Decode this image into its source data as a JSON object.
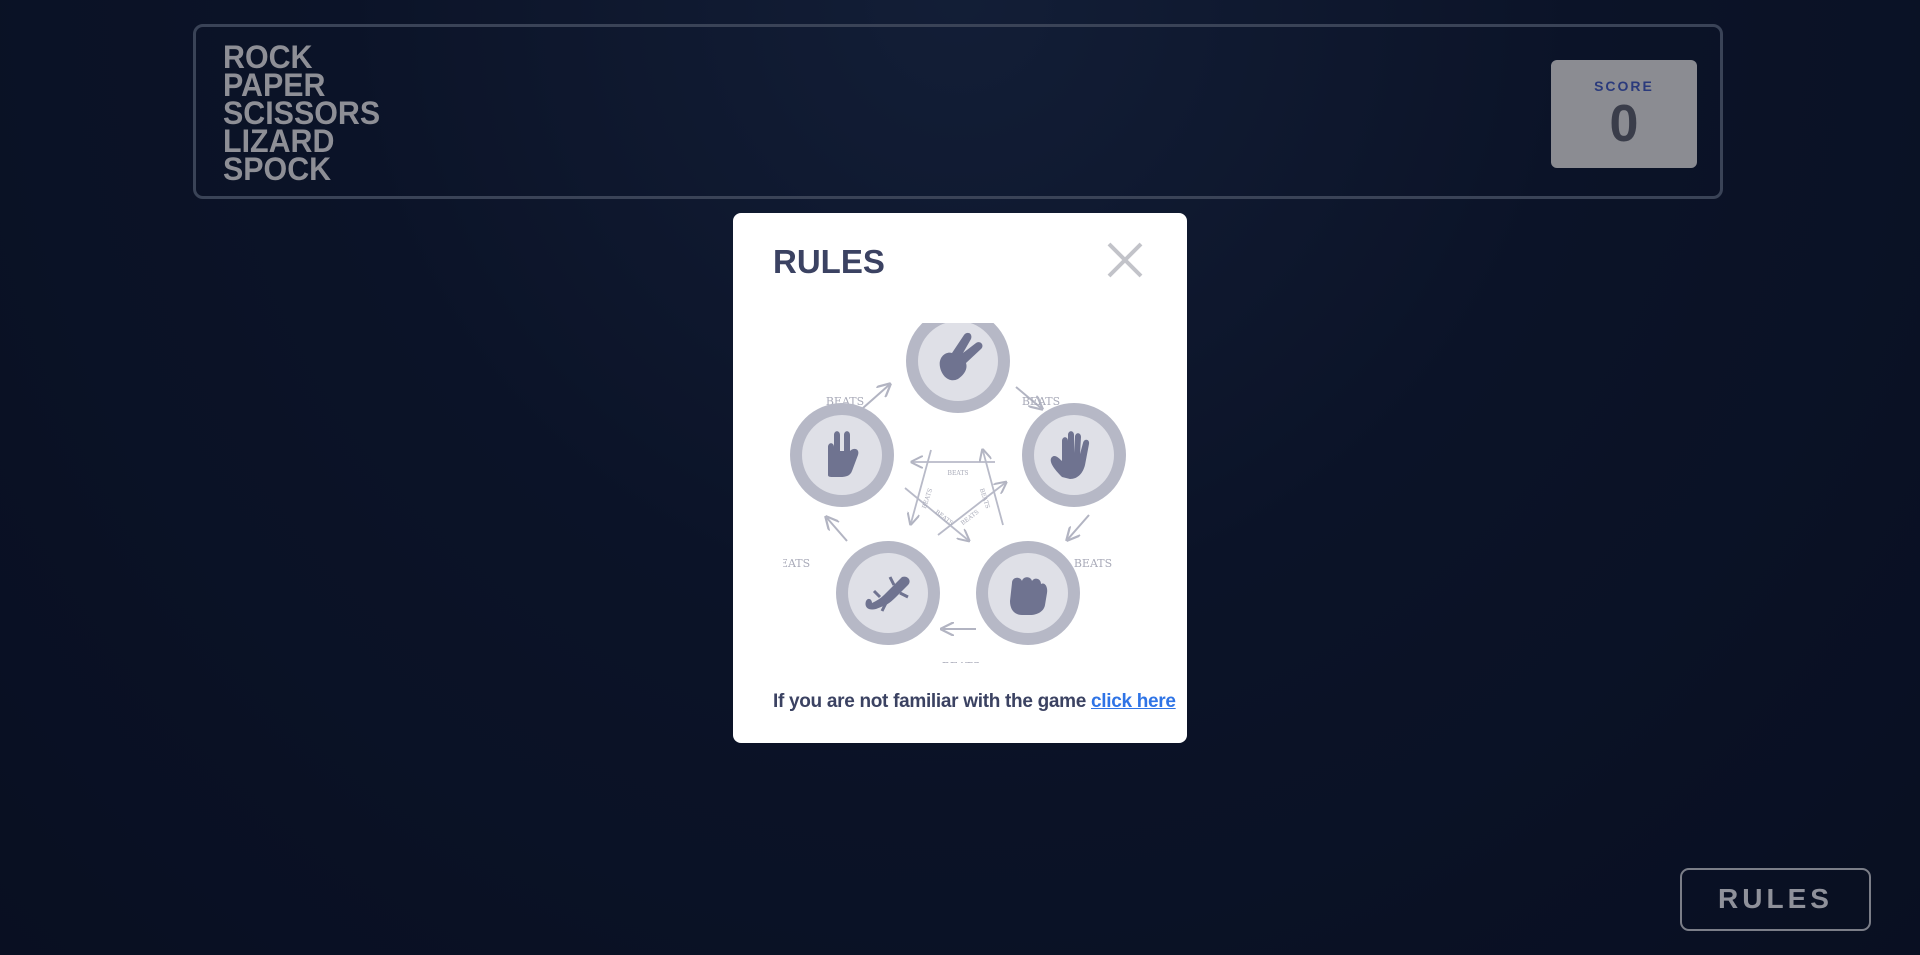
{
  "header": {
    "title_lines": [
      "ROCK",
      "PAPER",
      "SCISSORS",
      "LIZARD",
      "SPOCK"
    ],
    "score_label": "SCORE",
    "score_value": "0"
  },
  "modal": {
    "title": "RULES",
    "close_icon": "close-icon",
    "diagram": {
      "beats_label": "BEATS",
      "icons": [
        "scissors-icon",
        "paper-icon",
        "rock-icon",
        "lizard-icon",
        "spock-icon"
      ]
    },
    "footer_text": "If you are not familiar with the game",
    "footer_link": "click here"
  },
  "rules_button": {
    "label": "RULES"
  },
  "colors": {
    "background": "#0f1a32",
    "modal_title": "#3b4262",
    "link": "#2f74e6",
    "diagram_gray": "#b8bac8",
    "icon_fill": "#6f7390"
  }
}
